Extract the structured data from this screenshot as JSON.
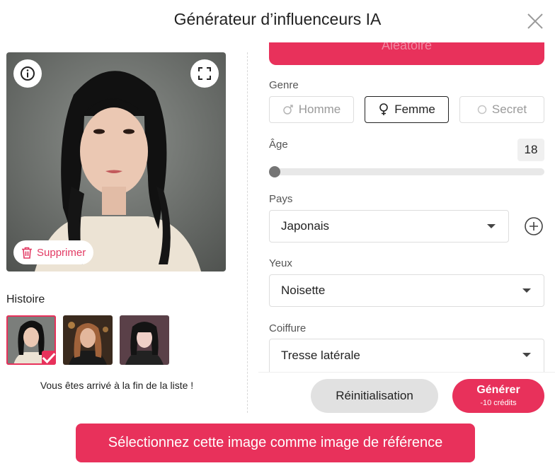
{
  "dialog": {
    "title": "Générateur d’influenceurs IA",
    "close_icon": "close-icon"
  },
  "preview": {
    "info_icon": "info-icon",
    "fullscreen_icon": "fullscreen-icon",
    "delete_label": "Supprimer",
    "delete_icon": "trash-icon"
  },
  "history": {
    "title": "Histoire",
    "thumbnails": [
      {
        "name": "history-thumb-1",
        "selected": true
      },
      {
        "name": "history-thumb-2",
        "selected": false
      },
      {
        "name": "history-thumb-3",
        "selected": false
      }
    ],
    "end_text": "Vous êtes arrivé à la fin de la liste !"
  },
  "form": {
    "random_button_label": "Aléatoire",
    "gender": {
      "label": "Genre",
      "options": [
        {
          "label": "Homme",
          "icon": "male-icon",
          "selected": false
        },
        {
          "label": "Femme",
          "icon": "female-icon",
          "selected": true
        },
        {
          "label": "Secret",
          "icon": "circle-icon",
          "selected": false
        }
      ]
    },
    "age": {
      "label": "Âge",
      "value": "18",
      "slider_fraction": 0
    },
    "country": {
      "label": "Pays",
      "value": "Japonais"
    },
    "eyes": {
      "label": "Yeux",
      "value": "Noisette"
    },
    "hair": {
      "label": "Coiffure",
      "value": "Tresse latérale"
    }
  },
  "actions": {
    "reset_label": "Réinitialisation",
    "generate_label": "Générer",
    "generate_cost": "-10 crédits",
    "reference_label": "Sélectionnez cette image comme image de référence"
  },
  "colors": {
    "accent": "#e8315b",
    "reset_bg": "#e1e1e1",
    "text": "#222222"
  }
}
